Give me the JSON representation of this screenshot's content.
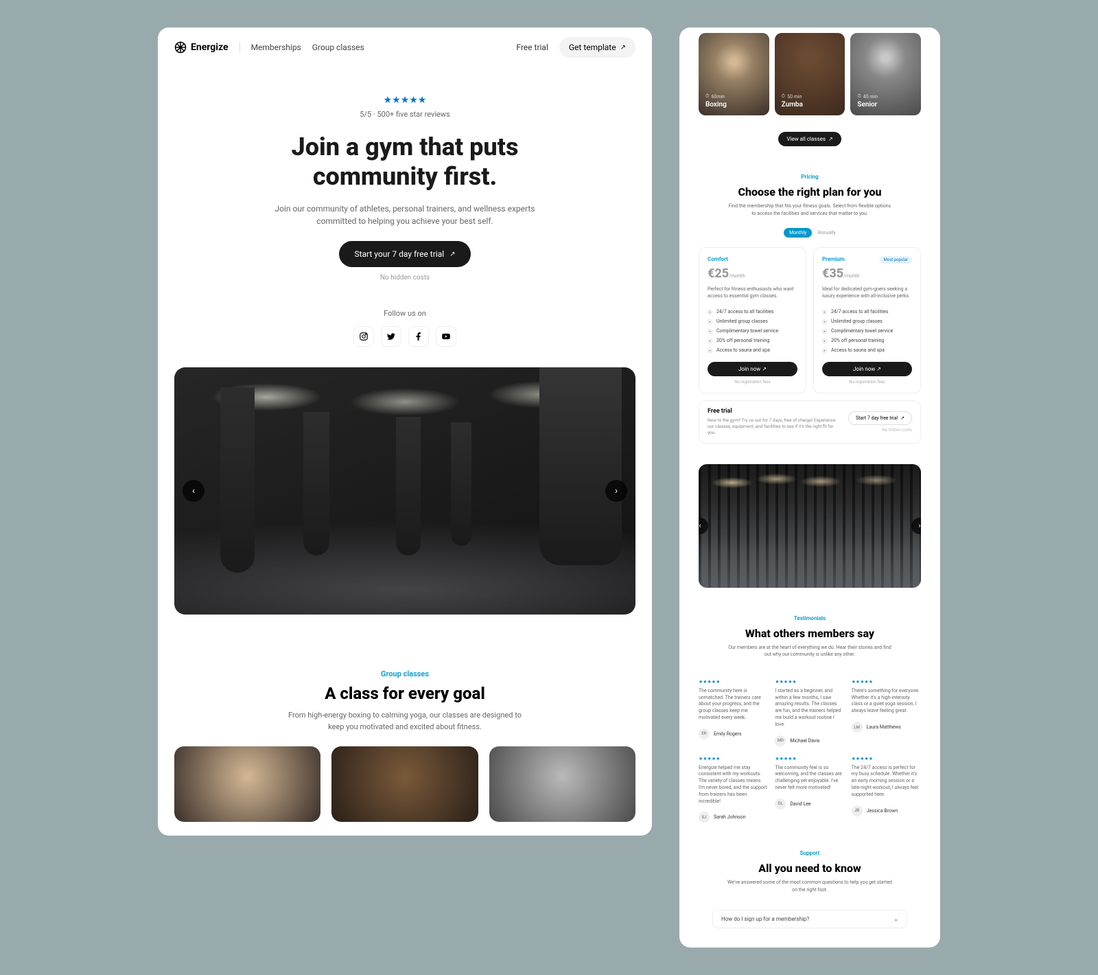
{
  "nav": {
    "logo": "Energize",
    "links": [
      "Memberships",
      "Group classes"
    ],
    "free_trial": "Free trial",
    "get_template": "Get template"
  },
  "hero": {
    "rating": "5/5 · 500+ five star reviews",
    "title_1": "Join a gym that puts",
    "title_2": "community first.",
    "subtitle": "Join our community of athletes, personal trainers, and wellness experts committed to helping you achieve your best self.",
    "cta": "Start your 7 day free trial",
    "no_hidden": "No hidden costs",
    "follow": "Follow us on"
  },
  "classes": {
    "eyebrow": "Group classes",
    "title": "A class for every goal",
    "subtitle": "From high-energy boxing to calming yoga, our classes are designed to keep you motivated and excited about fitness.",
    "items": [
      {
        "name": "Boxing",
        "duration": "60min"
      },
      {
        "name": "Zumba",
        "duration": "50 min"
      },
      {
        "name": "Senior",
        "duration": "45 min"
      }
    ],
    "view_all": "View all classes"
  },
  "pricing": {
    "eyebrow": "Pricing",
    "title": "Choose the right plan for you",
    "subtitle": "Find the membership that fits your fitness goals. Select from flexible options to access the facilities and services that matter to you.",
    "toggle": {
      "active": "Monthly",
      "inactive": "Annually"
    },
    "plans": [
      {
        "name": "Comfort",
        "price": "€25",
        "period": "/month",
        "desc": "Perfect for fitness enthusiasts who want access to essential gym classes.",
        "features": [
          "24/7 access to all facilities",
          "Unlimited group classes",
          "Complimentary towel service",
          "20% off personal training",
          "Access to sauna and spa"
        ],
        "cta": "Join now",
        "footer": "No registration fees"
      },
      {
        "name": "Premium",
        "badge": "Most popular",
        "price": "€35",
        "period": "/month",
        "desc": "Ideal for dedicated gym-goers seeking a luxury experience with all-inclusive perks.",
        "features": [
          "24/7 access to all facilities",
          "Unlimited group classes",
          "Complimentary towel service",
          "20% off personal training",
          "Access to sauna and spa"
        ],
        "cta": "Join now",
        "footer": "No registration fees"
      }
    ],
    "trial": {
      "title": "Free trial",
      "desc": "New to the gym? Try us out for 7 days, free of charge! Experience our classes, equipment, and facilities to see if it's the right fit for you.",
      "cta": "Start 7 day free trial",
      "footer": "No hidden costs"
    }
  },
  "testimonials": {
    "eyebrow": "Testimonials",
    "title": "What others members say",
    "subtitle": "Our members are at the heart of everything we do. Hear their stories and find out why our community is unlike any other.",
    "items": [
      {
        "initials": "ER",
        "name": "Emily Rogers",
        "text": "The community here is unmatched. The trainers care about your progress, and the group classes keep me motivated every week."
      },
      {
        "initials": "MD",
        "name": "Michael Davis",
        "text": "I started as a beginner, and within a few months, I saw amazing results. The classes are fun, and the trainers helped me build a workout routine I love."
      },
      {
        "initials": "LM",
        "name": "Laura Matthews",
        "text": "There's something for everyone. Whether it's a high-intensity class or a quiet yoga session, I always leave feeling great."
      },
      {
        "initials": "SJ",
        "name": "Sarah Johnson",
        "text": "Energize helped me stay consistent with my workouts. The variety of classes means I'm never bored, and the support from trainers has been incredible!"
      },
      {
        "initials": "DL",
        "name": "David Lee",
        "text": "The community feel is so welcoming, and the classes are challenging yet enjoyable. I've never felt more motivated!"
      },
      {
        "initials": "JB",
        "name": "Jessica Brown",
        "text": "The 24/7 access is perfect for my busy schedule. Whether it's an early morning session or a late-night workout, I always feel supported here."
      }
    ]
  },
  "support": {
    "eyebrow": "Support",
    "title": "All you need to know",
    "subtitle": "We've answered some of the most common questions to help you get started on the right foot.",
    "faq": "How do I sign up for a membership?"
  }
}
